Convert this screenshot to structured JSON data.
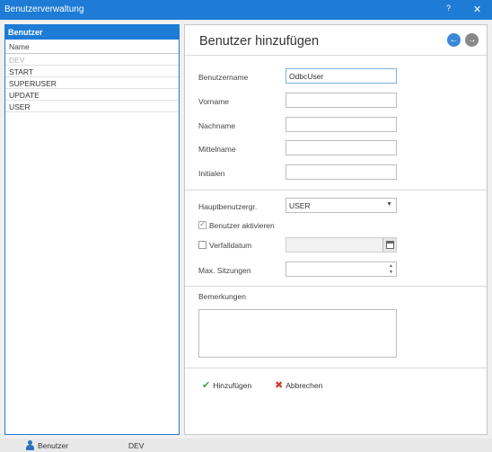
{
  "window": {
    "title": "Benutzerverwaltung",
    "help": "?",
    "close": "✕"
  },
  "list": {
    "header": "Benutzer",
    "column": "Name",
    "items": [
      "DEV",
      "START",
      "SUPERUSER",
      "UPDATE",
      "USER"
    ]
  },
  "form": {
    "title": "Benutzer hinzufügen",
    "nav_back": "←",
    "nav_forward": "→",
    "username_label": "Benutzername",
    "username_value": "OdbcUser",
    "firstname_label": "Vorname",
    "lastname_label": "Nachname",
    "middlename_label": "Mittelname",
    "initials_label": "Initialen",
    "group_label": "Hauptbenutzergr.",
    "group_value": "USER",
    "activate_label": "Benutzer aktivieren",
    "activate_checked": true,
    "expiry_label": "Verfalldatum",
    "expiry_checked": false,
    "sessions_label": "Max. Sitzungen",
    "remarks_label": "Bemerkungen",
    "add_label": "Hinzufügen",
    "cancel_label": "Abbrechen"
  },
  "status": {
    "user": "Benutzer",
    "database": "DEV"
  },
  "colors": {
    "accent": "#1e7bd6",
    "add": "#3ea24a",
    "cancel": "#d23a2f"
  }
}
